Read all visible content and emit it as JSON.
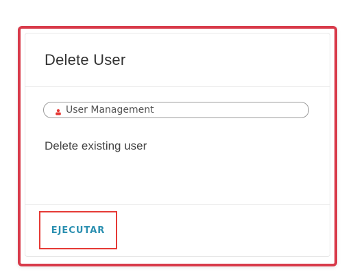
{
  "card": {
    "title": "Delete User",
    "tag": {
      "label": "User Management",
      "icon": "user-icon",
      "icon_color": "#e53935"
    },
    "description": "Delete existing user",
    "action_label": "EJECUTAR"
  },
  "colors": {
    "highlight": "#d83a4a",
    "action_text": "#2a8fb0",
    "action_outline": "#e53935"
  }
}
